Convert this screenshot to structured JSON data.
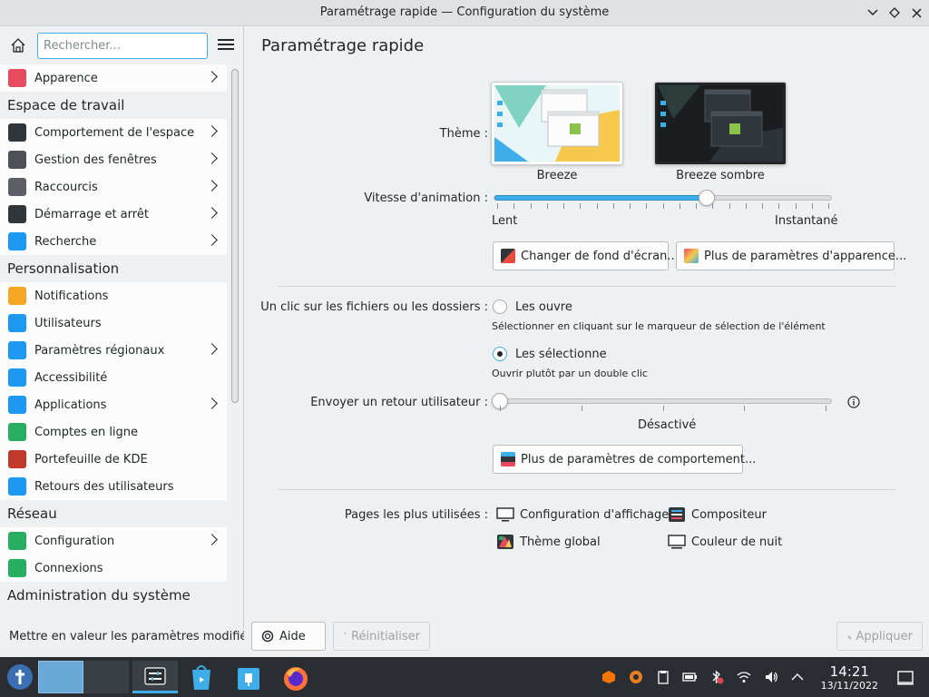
{
  "window": {
    "title": "Paramétrage rapide — Configuration du système"
  },
  "sidebar": {
    "search_placeholder": "Rechercher...",
    "items": [
      {
        "type": "item",
        "label": "Apparence",
        "icon": "appearance-icon",
        "color": "#e84a5f",
        "chevron": true
      },
      {
        "type": "category",
        "label": "Espace de travail"
      },
      {
        "type": "item",
        "label": "Comportement de l'espace ...",
        "icon": "workspace-behavior-icon",
        "color": "#31363b",
        "chevron": true
      },
      {
        "type": "item",
        "label": "Gestion des fenêtres",
        "icon": "window-management-icon",
        "color": "#4d5157",
        "chevron": true
      },
      {
        "type": "item",
        "label": "Raccourcis",
        "icon": "keyboard-icon",
        "color": "#5c6066",
        "chevron": true
      },
      {
        "type": "item",
        "label": "Démarrage et arrêt",
        "icon": "startup-icon",
        "color": "#31363b",
        "chevron": true
      },
      {
        "type": "item",
        "label": "Recherche",
        "icon": "search-icon",
        "color": "#1d99f3",
        "chevron": true
      },
      {
        "type": "category",
        "label": "Personnalisation"
      },
      {
        "type": "item",
        "label": "Notifications",
        "icon": "bell-icon",
        "color": "#f5a623",
        "chevron": false
      },
      {
        "type": "item",
        "label": "Utilisateurs",
        "icon": "users-icon",
        "color": "#1d99f3",
        "chevron": false
      },
      {
        "type": "item",
        "label": "Paramètres régionaux",
        "icon": "regional-icon",
        "color": "#1d99f3",
        "chevron": true
      },
      {
        "type": "item",
        "label": "Accessibilité",
        "icon": "accessibility-icon",
        "color": "#1d99f3",
        "chevron": false
      },
      {
        "type": "item",
        "label": "Applications",
        "icon": "applications-icon",
        "color": "#1d99f3",
        "chevron": true
      },
      {
        "type": "item",
        "label": "Comptes en ligne",
        "icon": "online-accounts-icon",
        "color": "#27ae60",
        "chevron": false
      },
      {
        "type": "item",
        "label": "Portefeuille de KDE",
        "icon": "wallet-icon",
        "color": "#c0392b",
        "chevron": false
      },
      {
        "type": "item",
        "label": "Retours des utilisateurs",
        "icon": "feedback-icon",
        "color": "#1d99f3",
        "chevron": false
      },
      {
        "type": "category",
        "label": "Réseau"
      },
      {
        "type": "item",
        "label": "Configuration",
        "icon": "network-config-icon",
        "color": "#27ae60",
        "chevron": true
      },
      {
        "type": "item",
        "label": "Connexions",
        "icon": "connections-icon",
        "color": "#27ae60",
        "chevron": false
      },
      {
        "type": "category",
        "label": "Administration du système"
      }
    ],
    "footer_label": "Mettre en valeur les paramètres modifiés"
  },
  "main": {
    "title": "Paramétrage rapide",
    "theme_label": "Thème :",
    "themes": [
      {
        "name": "Breeze"
      },
      {
        "name": "Breeze sombre"
      }
    ],
    "animation_label": "Vitesse d'animation :",
    "animation_value": 0.63,
    "animation_min": "Lent",
    "animation_max": "Instantané",
    "wallpaper_button": "Changer de fond d'écran...",
    "appearance_button": "Plus de paramètres d'apparence...",
    "click_label": "Un clic sur les fichiers ou les dossiers :",
    "click_option_open": "Les ouvre",
    "click_option_open_hint": "Sélectionner en cliquant sur le marqueur de sélection de l'élément",
    "click_option_select": "Les sélectionne",
    "click_option_select_hint": "Ouvrir plutôt par un double clic",
    "feedback_label": "Envoyer un retour utilisateur :",
    "feedback_value": 0,
    "feedback_state": "Désactivé",
    "behavior_button": "Plus de paramètres de comportement...",
    "most_used_label": "Pages les plus utilisées :",
    "most_used": [
      {
        "label": "Configuration d'affichage",
        "icon": "display-icon"
      },
      {
        "label": "Compositeur",
        "icon": "compositor-icon"
      },
      {
        "label": "Thème global",
        "icon": "global-theme-icon"
      },
      {
        "label": "Couleur de nuit",
        "icon": "night-color-icon"
      }
    ]
  },
  "footer": {
    "help": "Aide",
    "reset": "Réinitialiser",
    "apply": "Appliquer"
  },
  "taskbar": {
    "time": "14:21",
    "date": "13/11/2022"
  }
}
